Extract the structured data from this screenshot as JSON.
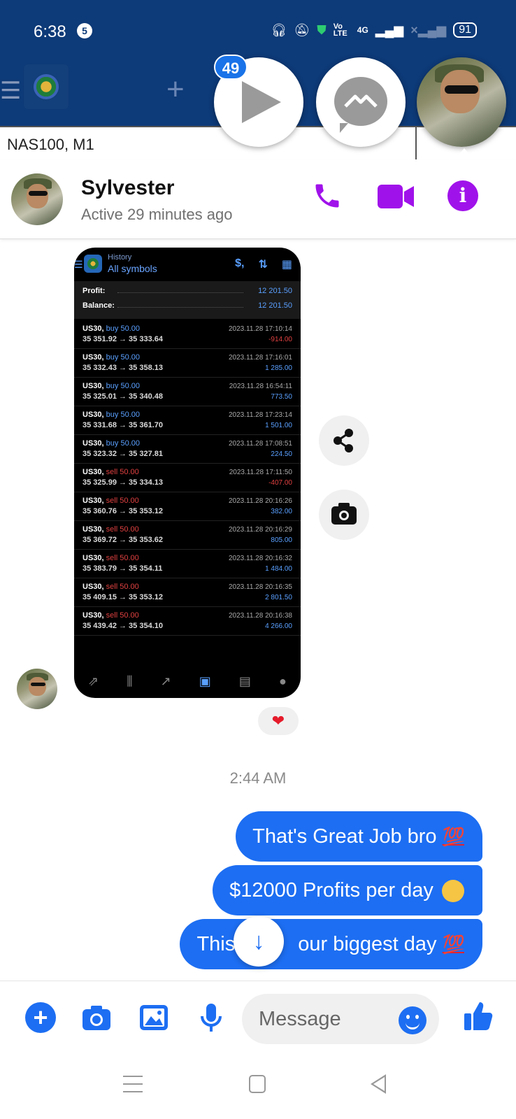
{
  "status_bar": {
    "time": "6:38",
    "notification_count": "5",
    "network": "Vo LTE",
    "signal": "4G",
    "battery": "91"
  },
  "background_app": {
    "symbol": "NAS100, M1"
  },
  "chat_heads": {
    "badge": "49"
  },
  "header": {
    "name": "Sylvester",
    "status": "Active 29 minutes ago"
  },
  "shared_screenshot": {
    "subtitle": "History",
    "title": "All symbols",
    "summary": {
      "profit_label": "Profit:",
      "profit_value": "12 201.50",
      "balance_label": "Balance:",
      "balance_value": "12 201.50"
    },
    "trades": [
      {
        "symbol": "US30,",
        "side": "buy",
        "volume": "50.00",
        "prices": "35 351.92 → 35 333.64",
        "date": "2023.11.28 17:10:14",
        "pnl": "-914.00"
      },
      {
        "symbol": "US30,",
        "side": "buy",
        "volume": "50.00",
        "prices": "35 332.43 → 35 358.13",
        "date": "2023.11.28 17:16:01",
        "pnl": "1 285.00"
      },
      {
        "symbol": "US30,",
        "side": "buy",
        "volume": "50.00",
        "prices": "35 325.01 → 35 340.48",
        "date": "2023.11.28 16:54:11",
        "pnl": "773.50"
      },
      {
        "symbol": "US30,",
        "side": "buy",
        "volume": "50.00",
        "prices": "35 331.68 → 35 361.70",
        "date": "2023.11.28 17:23:14",
        "pnl": "1 501.00"
      },
      {
        "symbol": "US30,",
        "side": "buy",
        "volume": "50.00",
        "prices": "35 323.32 → 35 327.81",
        "date": "2023.11.28 17:08:51",
        "pnl": "224.50"
      },
      {
        "symbol": "US30,",
        "side": "sell",
        "volume": "50.00",
        "prices": "35 325.99 → 35 334.13",
        "date": "2023.11.28 17:11:50",
        "pnl": "-407.00"
      },
      {
        "symbol": "US30,",
        "side": "sell",
        "volume": "50.00",
        "prices": "35 360.76 → 35 353.12",
        "date": "2023.11.28 20:16:26",
        "pnl": "382.00"
      },
      {
        "symbol": "US30,",
        "side": "sell",
        "volume": "50.00",
        "prices": "35 369.72 → 35 353.62",
        "date": "2023.11.28 20:16:29",
        "pnl": "805.00"
      },
      {
        "symbol": "US30,",
        "side": "sell",
        "volume": "50.00",
        "prices": "35 383.79 → 35 354.11",
        "date": "2023.11.28 20:16:32",
        "pnl": "1 484.00"
      },
      {
        "symbol": "US30,",
        "side": "sell",
        "volume": "50.00",
        "prices": "35 409.15 → 35 353.12",
        "date": "2023.11.28 20:16:35",
        "pnl": "2 801.50"
      },
      {
        "symbol": "US30,",
        "side": "sell",
        "volume": "50.00",
        "prices": "35 439.42 → 35 354.10",
        "date": "2023.11.28 20:16:38",
        "pnl": "4 266.00"
      }
    ]
  },
  "reaction": "❤",
  "timestamp": "2:44 AM",
  "messages": [
    {
      "text": "That's Great Job bro",
      "emoji": "100"
    },
    {
      "text": "$12000  Profits per day",
      "emoji": "money-mouth-face"
    },
    {
      "text_start": "This",
      "text_end": "our biggest day",
      "emoji": "100"
    }
  ],
  "composer": {
    "placeholder": "Message"
  },
  "colors": {
    "messenger_blue": "#1d6ef2",
    "accent_purple": "#a012ea",
    "background_app_blue": "#0d3a78"
  }
}
